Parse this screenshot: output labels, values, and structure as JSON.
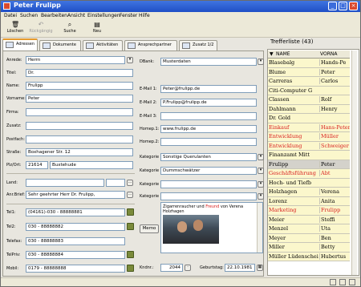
{
  "window": {
    "title": "Peter Frulipp"
  },
  "menu": [
    "Datei",
    "Suchen",
    "Bearbeiten",
    "Ansicht",
    "Einstellungen",
    "Fenster",
    "Hilfe"
  ],
  "toolbar": [
    {
      "label": "Löschen",
      "icon": "trash-icon",
      "disabled": false
    },
    {
      "label": "Rückgängig",
      "icon": "undo-icon",
      "disabled": true
    },
    {
      "label": "Suche",
      "icon": "search-icon",
      "disabled": false
    },
    {
      "label": "Neu",
      "icon": "new-icon",
      "disabled": false
    }
  ],
  "tabs": [
    "Adressen",
    "Dokumente",
    "Aktivitäten",
    "Ansprechpartner",
    "Zusatz 1/2"
  ],
  "form": {
    "anrede": {
      "label": "Anrede:",
      "value": "Herrn"
    },
    "titel": {
      "label": "Titel:",
      "value": "Dr."
    },
    "name": {
      "label": "Name:",
      "value": "Frulipp"
    },
    "vorname": {
      "label": "Vorname:",
      "value": "Peter"
    },
    "firma": {
      "label": "Firma:",
      "value": ""
    },
    "zusatz": {
      "label": "Zusatz:",
      "value": ""
    },
    "postfach": {
      "label": "Postfach:",
      "value": ""
    },
    "strasse": {
      "label": "Straße:",
      "value": "Boxhagener Str. 12"
    },
    "plz": {
      "label": "Plz/Ort:",
      "plz": "21614",
      "ort": "Buxtehude"
    },
    "land": {
      "label": "Land:",
      "value": ""
    },
    "anr_brief": {
      "label": "Anr.Brief:",
      "value": "Sehr geehrter Herr Dr. Frulipp,"
    },
    "tel1": {
      "label": "Tel1:",
      "value": "(04161)-030 - 88888881"
    },
    "tel2": {
      "label": "Tel2:",
      "value": "030 - 88888882"
    },
    "telefax": {
      "label": "Telefax:",
      "value": "030 - 88888883"
    },
    "telpriv": {
      "label": "TelPriv:",
      "value": "030 - 88888884"
    },
    "mobil": {
      "label": "Mobil:",
      "value": "0179 - 88888888"
    },
    "dbank": {
      "label": "DBank:",
      "value": "Musterdaten"
    },
    "email1": {
      "label": "E-Mail 1:",
      "value": "Peter@frulipp.de"
    },
    "email2": {
      "label": "E-Mail 2:",
      "value": "P.Frulipp@frulipp.de"
    },
    "email3": {
      "label": "E-Mail 3:",
      "value": ""
    },
    "homep1": {
      "label": "Homep.1:",
      "value": "www.frulipp.de"
    },
    "homep2": {
      "label": "Homep.2:",
      "value": ""
    },
    "kategorien": [
      {
        "label": "Kategorie",
        "value": "Sonstige Querulanten"
      },
      {
        "label": "Kategorie",
        "value": "Dummschwätzer"
      },
      {
        "label": "Kategorie",
        "value": ""
      },
      {
        "label": "Kategorie",
        "value": ""
      }
    ],
    "memo_button": "Memo",
    "memo_caption_1": "Zigarrenraucher und ",
    "memo_caption_red": "Freund",
    "memo_caption_2": " von Verena",
    "memo_caption_3": "Holzhagen",
    "kndnr": {
      "label": "Kndnr.:",
      "value": "2044"
    },
    "geburtstag": {
      "label": "Geburtstag:",
      "value": "22.10.1981"
    }
  },
  "trefferliste": {
    "title": "Trefferliste (43)",
    "columns": [
      "NAME",
      "VORNA"
    ],
    "rows": [
      {
        "name": "Blasebalg",
        "vorname": "Hands-Pe",
        "red": false,
        "sel": false
      },
      {
        "name": "Blume",
        "vorname": "Peter",
        "red": false,
        "sel": false
      },
      {
        "name": "Carreras",
        "vorname": "Carlos",
        "red": false,
        "sel": false
      },
      {
        "name": "Citi-Computer G",
        "vorname": "",
        "red": false,
        "sel": false
      },
      {
        "name": "Classen",
        "vorname": "Rolf",
        "red": false,
        "sel": false
      },
      {
        "name": "Dahlmann",
        "vorname": "Henry",
        "red": false,
        "sel": false
      },
      {
        "name": "Dr. Gold",
        "vorname": "",
        "red": false,
        "sel": false
      },
      {
        "name": "Einkauf",
        "vorname": "Hans-Peter",
        "red": true,
        "sel": false
      },
      {
        "name": "Entwicklung",
        "vorname": "Müller",
        "red": true,
        "sel": false
      },
      {
        "name": "Entwicklung",
        "vorname": "Schweiger",
        "red": true,
        "sel": false
      },
      {
        "name": "Finanzamt Mitt",
        "vorname": "",
        "red": false,
        "sel": false
      },
      {
        "name": "Frulipp",
        "vorname": "Peter",
        "red": false,
        "sel": true
      },
      {
        "name": "Geschäftsführung",
        "vorname": "Abt",
        "red": true,
        "sel": false
      },
      {
        "name": "Hoch- und Tiefb",
        "vorname": "",
        "red": false,
        "sel": false
      },
      {
        "name": "Holzhagen",
        "vorname": "Verena",
        "red": false,
        "sel": false
      },
      {
        "name": "Lorenz",
        "vorname": "Anita",
        "red": false,
        "sel": false
      },
      {
        "name": "Marketing",
        "vorname": "Frulipp",
        "red": true,
        "sel": false
      },
      {
        "name": "Meier",
        "vorname": "Steffi",
        "red": false,
        "sel": false
      },
      {
        "name": "Menzel",
        "vorname": "Uta",
        "red": false,
        "sel": false
      },
      {
        "name": "Meyer",
        "vorname": "Ben",
        "red": false,
        "sel": false
      },
      {
        "name": "Miller",
        "vorname": "Betty",
        "red": false,
        "sel": false
      },
      {
        "name": "Müller Lüdenscheid",
        "vorname": "Hubertus",
        "red": false,
        "sel": false
      }
    ]
  }
}
